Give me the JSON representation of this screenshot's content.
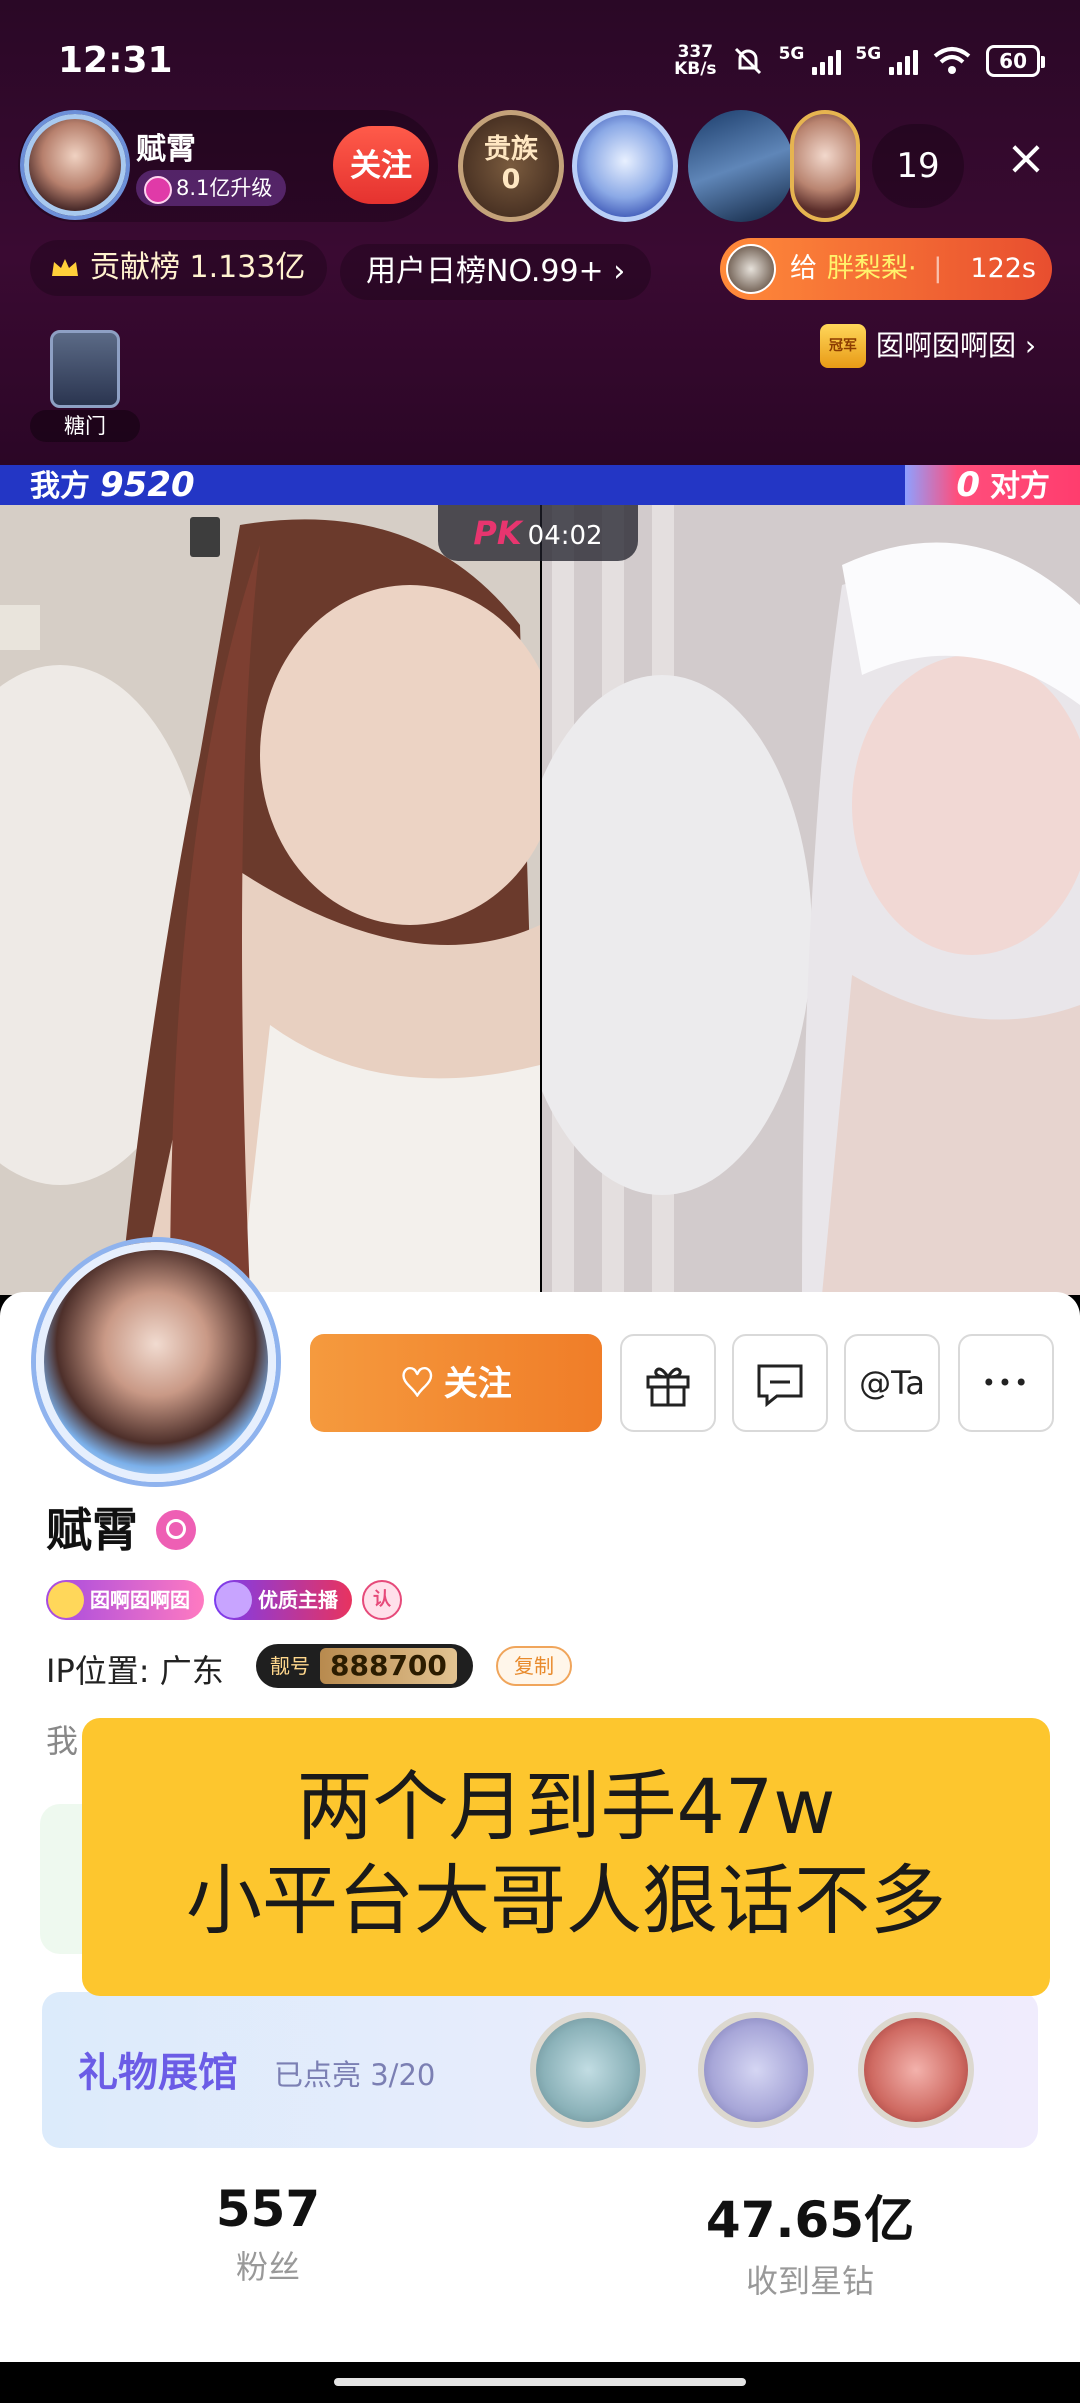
{
  "status_bar": {
    "time": "12:31",
    "net_speed_value": "337",
    "net_speed_unit": "KB/s",
    "sig1": "5G",
    "sig2": "5G",
    "battery": "60"
  },
  "live_header": {
    "host_name": "赋霄",
    "host_level": "8.1亿升级",
    "follow_label": "关注",
    "guizu_label": "贵族",
    "guizu_count": "0",
    "viewer_count": "19",
    "close_icon": "×",
    "contribution_label": "贡献榜 1.133亿",
    "daily_rank_label": "用户日榜NO.99+",
    "daily_rank_chevron": "›",
    "gift_banner": {
      "prefix": "给",
      "name": "胖梨梨·",
      "divider": "|",
      "time": "122s"
    },
    "champion_badge": "冠军",
    "champion_label": "囡啊囡啊囡",
    "champion_chevron": "›",
    "tangmen_label": "糖门"
  },
  "pk": {
    "left_label": "我方",
    "left_score": "9520",
    "right_score": "0",
    "right_label": "对方",
    "logo": "PK",
    "timer": "04:02"
  },
  "profile": {
    "follow_label": "关注",
    "at_label": "@Ta",
    "more_icon": "•••",
    "name": "赋霄",
    "badge1_label": "囡啊囡啊囡",
    "badge2_label": "优质主播",
    "badge3_label": "认",
    "ip_label": "IP位置: 广东",
    "liang_tag": "靓号",
    "liang_number": "888700",
    "copy_label": "复制",
    "bio_stub": "我",
    "gallery_title": "礼物展馆",
    "gallery_sub": "已点亮 3/20",
    "fans_count": "557",
    "fans_label": "粉丝",
    "stars_count": "47.65亿",
    "stars_label": "收到星钻"
  },
  "overlay": {
    "line1": "两个月到手47w",
    "line2": "小平台大哥人狠话不多"
  },
  "colors": {
    "accent_orange": "#f07d28",
    "pk_blue": "#2336c5",
    "pk_red": "#ff3d6e",
    "overlay_yellow": "#fdc62e"
  }
}
